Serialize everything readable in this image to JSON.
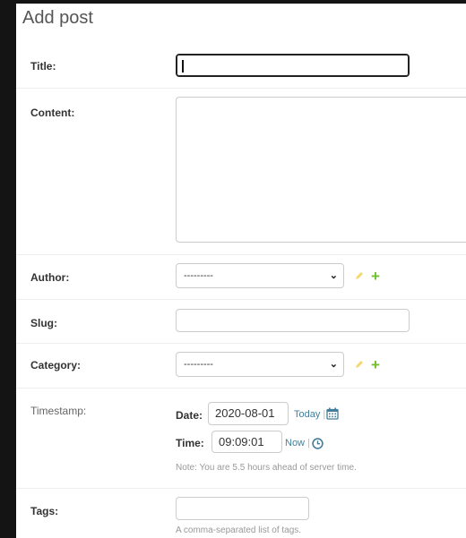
{
  "page": {
    "title": "Add post"
  },
  "fields": {
    "title": {
      "label": "Title:",
      "value": ""
    },
    "content": {
      "label": "Content:",
      "value": ""
    },
    "author": {
      "label": "Author:",
      "selected": "---------"
    },
    "slug": {
      "label": "Slug:",
      "value": ""
    },
    "category": {
      "label": "Category:",
      "selected": "---------"
    },
    "timestamp": {
      "label": "Timestamp:",
      "date_label": "Date:",
      "date_value": "2020-08-01",
      "today_link": "Today",
      "time_label": "Time:",
      "time_value": "09:09:01",
      "now_link": "Now",
      "note": "Note: You are 5.5 hours ahead of server time."
    },
    "tags": {
      "label": "Tags:",
      "value": "",
      "help": "A comma-separated list of tags."
    }
  },
  "separator": "|",
  "colors": {
    "accent": "#447e9b",
    "add": "#70bf2b",
    "change": "#efb80b"
  },
  "icons": {
    "select_arrow": "chevron-down-icon",
    "calendar": "calendar-icon",
    "clock": "clock-icon",
    "change": "pencil-icon",
    "add": "plus-icon"
  }
}
